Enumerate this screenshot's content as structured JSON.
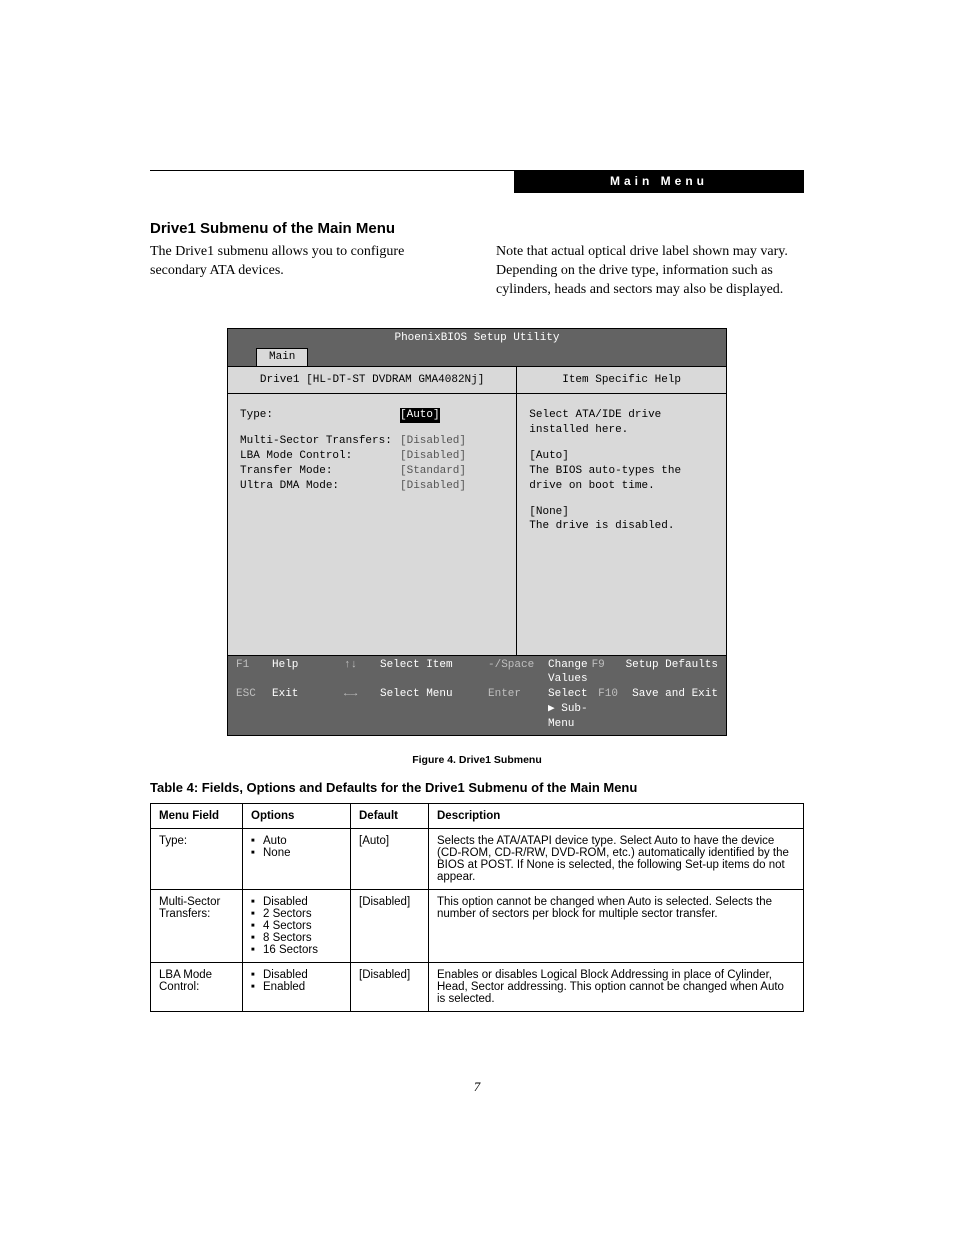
{
  "header": {
    "tab": "Main Menu"
  },
  "section_title": "Drive1 Submenu of the Main Menu",
  "intro": {
    "left": "The Drive1 submenu allows you to configure secondary ATA devices.",
    "right": "Note that actual optical drive label shown may vary. Depending on the drive type, information such as cylinders, heads and sectors may also be displayed."
  },
  "bios": {
    "title": "PhoenixBIOS Setup Utility",
    "tab": "Main",
    "left_heading": "Drive1 [HL-DT-ST DVDRAM GMA4082Nj]",
    "right_heading": "Item Specific Help",
    "fields": {
      "type": {
        "label": "Type:",
        "value": "[Auto]",
        "selected": true
      },
      "mst": {
        "label": "Multi-Sector Transfers:",
        "value": "[Disabled]",
        "selected": false
      },
      "lba": {
        "label": "LBA Mode Control:",
        "value": "[Disabled]",
        "selected": false
      },
      "xfer": {
        "label": "Transfer Mode:",
        "value": "[Standard]",
        "selected": false
      },
      "udma": {
        "label": "Ultra DMA Mode:",
        "value": "[Disabled]",
        "selected": false
      }
    },
    "help": {
      "l1": "Select ATA/IDE drive",
      "l2": "installed here.",
      "l3": "[Auto]",
      "l4": "The BIOS auto-types the",
      "l5": "drive on boot time.",
      "l6": "[None]",
      "l7": "The drive is disabled."
    },
    "footer": {
      "r1": {
        "k1": "F1",
        "a1": "Help",
        "k2": "↑↓",
        "a2": "Select Item",
        "k3": "-/Space",
        "a3": "Change Values",
        "k4": "F9",
        "a4": "Setup Defaults"
      },
      "r2": {
        "k1": "ESC",
        "a1": "Exit",
        "k2": "←→",
        "a2": "Select Menu",
        "k3": "Enter",
        "a3": "Select ▶ Sub-Menu",
        "k4": "F10",
        "a4": "Save and Exit"
      }
    }
  },
  "figure_caption": "Figure 4.  Drive1 Submenu",
  "table_caption": "Table 4: Fields, Options and Defaults for the Drive1 Submenu of the Main Menu",
  "table": {
    "head": {
      "c1": "Menu Field",
      "c2": "Options",
      "c3": "Default",
      "c4": "Description"
    },
    "rows": [
      {
        "field": "Type:",
        "options": [
          "Auto",
          "None"
        ],
        "default": "[Auto]",
        "desc": "Selects the ATA/ATAPI device type. Select Auto to have the device (CD-ROM, CD-R/RW, DVD-ROM, etc.) automatically identified by the BIOS at POST. If None is selected, the following Set-up items do not appear."
      },
      {
        "field": "Multi-Sector Transfers:",
        "options": [
          "Disabled",
          "2 Sectors",
          "4 Sectors",
          "8 Sectors",
          "16 Sectors"
        ],
        "default": "[Disabled]",
        "desc": "This option cannot be changed when Auto is selected. Selects the number of sectors per block for multiple sector transfer."
      },
      {
        "field": "LBA Mode Control:",
        "options": [
          "Disabled",
          "Enabled"
        ],
        "default": "[Disabled]",
        "desc": "Enables or disables Logical Block Addressing in place of Cylinder, Head, Sector addressing. This option cannot be changed when Auto is selected."
      }
    ]
  },
  "page_number": "7"
}
